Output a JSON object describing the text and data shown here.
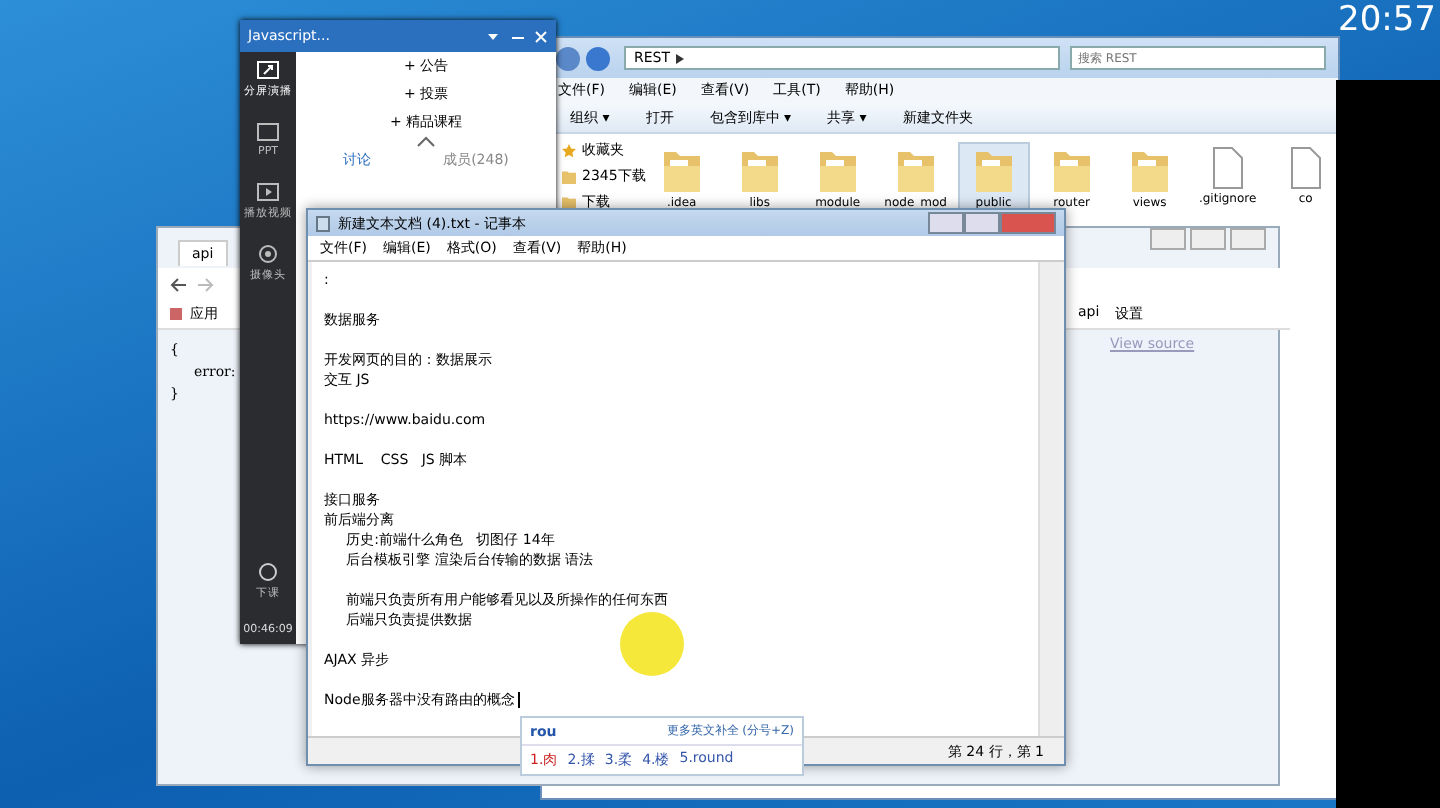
{
  "clock": {
    "time": "20:57"
  },
  "explorer": {
    "path": "REST",
    "search": {
      "placeholder": "搜索 REST"
    },
    "menu": [
      "文件(F)",
      "编辑(E)",
      "查看(V)",
      "工具(T)",
      "帮助(H)"
    ],
    "toolbar": [
      "组织 ▾",
      "打开",
      "包含到库中 ▾",
      "共享 ▾",
      "新建文件夹"
    ],
    "sidebar": [
      {
        "label": "收藏夹",
        "kind": "star"
      },
      {
        "label": "2345下载",
        "kind": "folder"
      },
      {
        "label": "下载",
        "kind": "folder"
      }
    ],
    "files": [
      {
        "name": ".idea",
        "kind": "folder",
        "selected": false
      },
      {
        "name": "libs",
        "kind": "folder",
        "selected": false
      },
      {
        "name": "module",
        "kind": "folder",
        "selected": false
      },
      {
        "name": "node_mod",
        "kind": "folder",
        "selected": false
      },
      {
        "name": "public",
        "kind": "folder",
        "selected": true
      },
      {
        "name": "router",
        "kind": "folder",
        "selected": false
      },
      {
        "name": "views",
        "kind": "folder",
        "selected": false
      },
      {
        "name": ".gitignore",
        "kind": "file",
        "selected": false
      },
      {
        "name": "co",
        "kind": "file",
        "selected": false
      }
    ]
  },
  "browser": {
    "tab": "api",
    "bookmarks_left": [
      "应用"
    ],
    "bookmarks_right": [
      "api",
      "设置"
    ],
    "content": [
      "{",
      "error:",
      "}"
    ],
    "view_source": "View source"
  },
  "recorder": {
    "title": "Javascript...",
    "tools": [
      {
        "label": "分屏演播",
        "kind": "share"
      },
      {
        "label": "PPT",
        "kind": "ppt"
      },
      {
        "label": "播放视频",
        "kind": "video"
      },
      {
        "label": "摄像头",
        "kind": "camera"
      }
    ],
    "end_label": "下课",
    "timer": "00:46:09",
    "items": [
      "+ 公告",
      "+ 投票",
      "+ 精品课程"
    ],
    "tabs": [
      {
        "label": "讨论",
        "selected": true
      },
      {
        "label": "成员(248)",
        "selected": false
      }
    ]
  },
  "notepad": {
    "title": "新建文本文档 (4).txt - 记事本",
    "menu": [
      "文件(F)",
      "编辑(E)",
      "格式(O)",
      "查看(V)",
      "帮助(H)"
    ],
    "paragraphs": [
      [
        ":"
      ],
      [
        "数据服务"
      ],
      [
        "开发网页的目的：数据展示",
        "交互 JS"
      ],
      [
        "https://www.baidu.com"
      ],
      [
        "HTML    CSS   JS 脚本"
      ],
      [
        "接口服务",
        "前后端分离",
        "\t历史:前端什么角色   切图仔 14年",
        "\t后台模板引擎 渲染后台传输的数据 语法"
      ],
      [
        "\t前端只负责所有用户能够看见以及所操作的任何东西",
        "\t后端只负责提供数据"
      ],
      [
        "AJAX 异步"
      ],
      [
        "Node服务器中没有路由的概念"
      ]
    ],
    "status": "第 24 行，第 1"
  },
  "ime": {
    "input": "rou",
    "hint": "更多英文补全 (分号+Z)",
    "candidates": [
      "1.肉",
      "2.揉",
      "3.柔",
      "4.楼",
      "5.round"
    ]
  }
}
